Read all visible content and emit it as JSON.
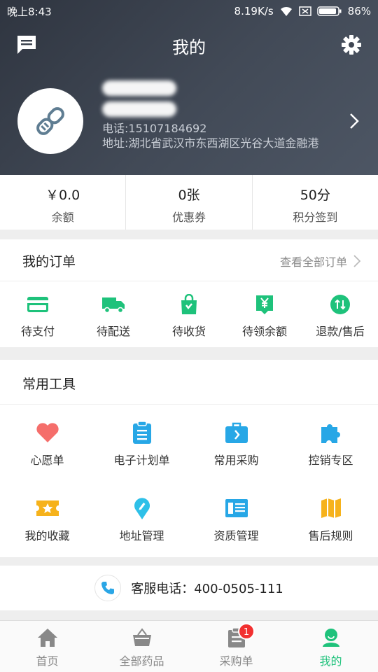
{
  "status_bar": {
    "time": "晚上8:43",
    "speed": "8.19K/s",
    "battery": "86%"
  },
  "header": {
    "title": "我的"
  },
  "profile": {
    "phone": "电话:15107184692",
    "address": "地址:湖北省武汉市东西湖区光谷大道金融港"
  },
  "stats": [
    {
      "value": "￥0.0",
      "label": "余额"
    },
    {
      "value": "0张",
      "label": "优惠券"
    },
    {
      "value": "50分",
      "label": "积分签到"
    }
  ],
  "orders": {
    "title": "我的订单",
    "view_all": "查看全部订单",
    "items": [
      {
        "label": "待支付",
        "icon": "card-icon"
      },
      {
        "label": "待配送",
        "icon": "truck-icon"
      },
      {
        "label": "待收货",
        "icon": "bag-icon"
      },
      {
        "label": "待领余额",
        "icon": "yen-icon"
      },
      {
        "label": "退款/售后",
        "icon": "refund-icon"
      }
    ]
  },
  "tools": {
    "title": "常用工具",
    "items": [
      {
        "label": "心愿单",
        "icon": "heart-icon"
      },
      {
        "label": "电子计划单",
        "icon": "clipboard-icon"
      },
      {
        "label": "常用采购",
        "icon": "briefcase-icon"
      },
      {
        "label": "控销专区",
        "icon": "puzzle-icon"
      },
      {
        "label": "我的收藏",
        "icon": "star-ticket-icon"
      },
      {
        "label": "地址管理",
        "icon": "location-icon"
      },
      {
        "label": "资质管理",
        "icon": "certificate-icon"
      },
      {
        "label": "售后规则",
        "icon": "map-icon"
      }
    ]
  },
  "service": {
    "label": "客服电话：400-0505-111"
  },
  "tabbar": {
    "tabs": [
      {
        "label": "首页"
      },
      {
        "label": "全部药品"
      },
      {
        "label": "采购单"
      },
      {
        "label": "我的"
      }
    ],
    "cart_badge": "1"
  },
  "colors": {
    "accent": "#1ec27b",
    "header_bg": "#363d49",
    "badge": "#f23030"
  }
}
